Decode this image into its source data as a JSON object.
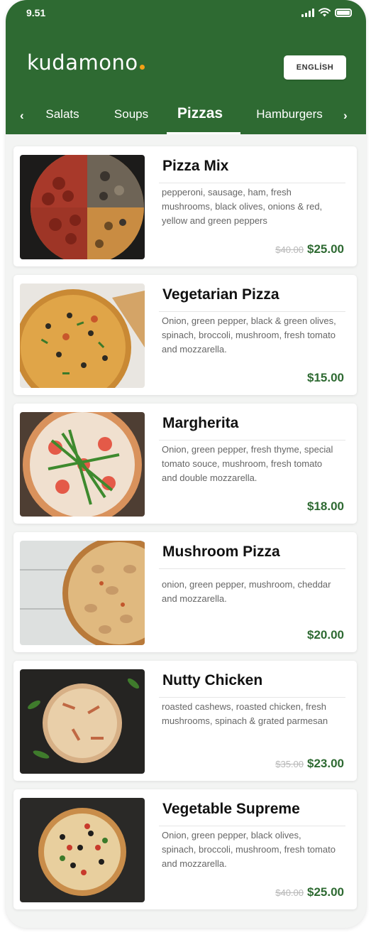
{
  "status": {
    "time": "9.51"
  },
  "header": {
    "logo": "kudamono",
    "language_button": "ENGLİSH"
  },
  "tabs": [
    "Salats",
    "Soups",
    "Pizzas",
    "Hamburgers"
  ],
  "active_tab": "Pizzas",
  "colors": {
    "brand_green": "#2e6a32",
    "logo_dot": "#f2a116",
    "price": "#2e6a32",
    "old_price": "#b8b8b8"
  },
  "items": [
    {
      "name": "Pizza Mix",
      "description": "pepperoni, sausage, ham, fresh mushrooms, black olives, onions & red, yellow and green peppers",
      "old_price": "$40.00",
      "price": "$25.00"
    },
    {
      "name": "Vegetarian Pizza",
      "description": "Onion, green pepper, black & green olives, spinach, broccoli, mushroom, fresh tomato and mozzarella.",
      "old_price": "",
      "price": "$15.00"
    },
    {
      "name": "Margherita",
      "description": "Onion, green pepper, fresh thyme, special tomato souce, mushroom, fresh tomato and double mozzarella.",
      "old_price": "",
      "price": "$18.00"
    },
    {
      "name": "Mushroom Pizza",
      "description": "onion, green pepper, mushroom, cheddar and mozzarella.",
      "old_price": "",
      "price": "$20.00"
    },
    {
      "name": "Nutty Chicken",
      "description": "roasted cashews, roasted chicken, fresh mushrooms, spinach & grated parmesan",
      "old_price": "$35.00",
      "price": "$23.00"
    },
    {
      "name": "Vegetable Supreme",
      "description": "Onion, green pepper, black olives, spinach, broccoli, mushroom, fresh tomato and mozzarella.",
      "old_price": "$40.00",
      "price": "$25.00"
    }
  ]
}
